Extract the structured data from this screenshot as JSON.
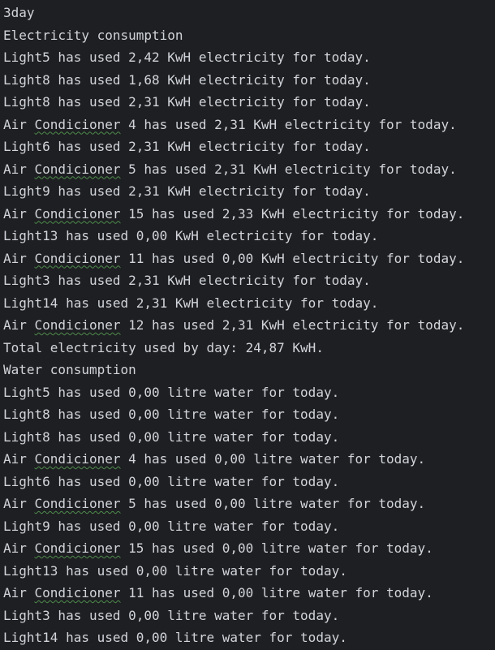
{
  "console": {
    "lines": [
      {
        "text": "3day"
      },
      {
        "text": "Electricity consumption"
      },
      {
        "text": "Light5 has used 2,42 KwH electricity for today."
      },
      {
        "text": "Light8 has used 1,68 KwH electricity for today."
      },
      {
        "text": "Light8 has used 2,31 KwH electricity for today."
      },
      {
        "prefix": "Air ",
        "flagged": "Condicioner",
        "suffix": " 4 has used 2,31 KwH electricity for today."
      },
      {
        "text": "Light6 has used 2,31 KwH electricity for today."
      },
      {
        "prefix": "Air ",
        "flagged": "Condicioner",
        "suffix": " 5 has used 2,31 KwH electricity for today."
      },
      {
        "text": "Light9 has used 2,31 KwH electricity for today."
      },
      {
        "prefix": "Air ",
        "flagged": "Condicioner",
        "suffix": " 15 has used 2,33 KwH electricity for today."
      },
      {
        "text": "Light13 has used 0,00 KwH electricity for today."
      },
      {
        "prefix": "Air ",
        "flagged": "Condicioner",
        "suffix": " 11 has used 0,00 KwH electricity for today."
      },
      {
        "text": "Light3 has used 2,31 KwH electricity for today."
      },
      {
        "text": "Light14 has used 2,31 KwH electricity for today."
      },
      {
        "prefix": "Air ",
        "flagged": "Condicioner",
        "suffix": " 12 has used 2,31 KwH electricity for today."
      },
      {
        "text": "Total electricity used by day: 24,87 KwH."
      },
      {
        "text": "Water consumption"
      },
      {
        "text": "Light5 has used 0,00 litre water for today."
      },
      {
        "text": "Light8 has used 0,00 litre water for today."
      },
      {
        "text": "Light8 has used 0,00 litre water for today."
      },
      {
        "prefix": "Air ",
        "flagged": "Condicioner",
        "suffix": " 4 has used 0,00 litre water for today."
      },
      {
        "text": "Light6 has used 0,00 litre water for today."
      },
      {
        "prefix": "Air ",
        "flagged": "Condicioner",
        "suffix": " 5 has used 0,00 litre water for today."
      },
      {
        "text": "Light9 has used 0,00 litre water for today."
      },
      {
        "prefix": "Air ",
        "flagged": "Condicioner",
        "suffix": " 15 has used 0,00 litre water for today."
      },
      {
        "text": "Light13 has used 0,00 litre water for today."
      },
      {
        "prefix": "Air ",
        "flagged": "Condicioner",
        "suffix": " 11 has used 0,00 litre water for today."
      },
      {
        "text": "Light3 has used 0,00 litre water for today."
      },
      {
        "text": "Light14 has used 0,00 litre water for today."
      }
    ]
  },
  "colors": {
    "background": "#1e1f22",
    "text": "#d1d4da",
    "typo_underline": "#4e8b4c"
  }
}
